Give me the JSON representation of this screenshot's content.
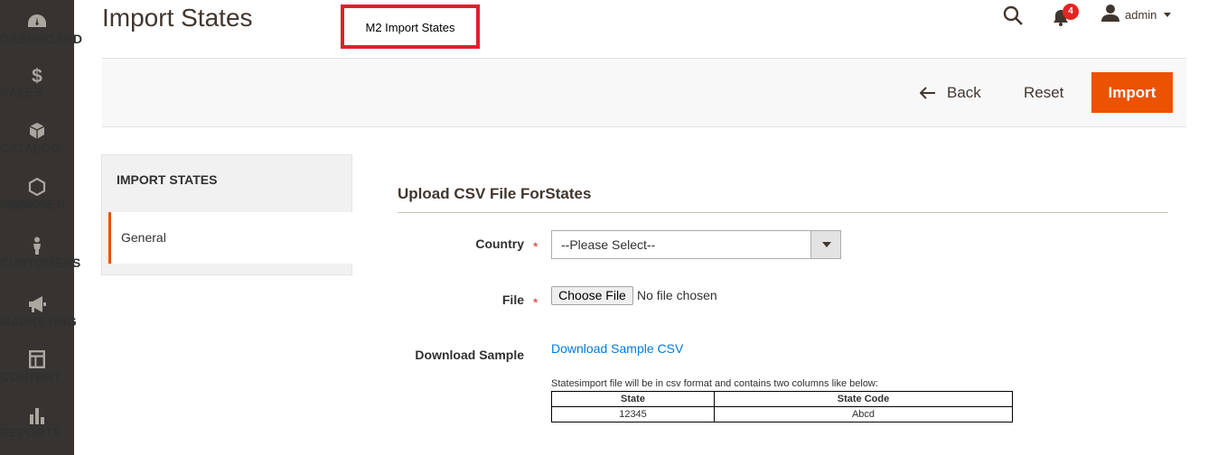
{
  "nav": {
    "items": [
      {
        "label": "DASHBOARD",
        "icon": "dashboard-icon"
      },
      {
        "label": "SALES",
        "icon": "dollar-icon"
      },
      {
        "label": "CATALOG",
        "icon": "cube-icon"
      },
      {
        "label": "REGION",
        "label2": "MANAGER",
        "icon": "hexagon-icon"
      },
      {
        "label": "CUSTOMERS",
        "icon": "person-icon"
      },
      {
        "label": "MARKETING",
        "icon": "megaphone-icon"
      },
      {
        "label": "CONTENT",
        "icon": "layout-icon"
      },
      {
        "label": "REPORTS",
        "icon": "bar-chart-icon"
      }
    ]
  },
  "header": {
    "title": "Import States",
    "tag": "M2 Import States",
    "notifications_count": "4",
    "user": "admin"
  },
  "actions": {
    "back": "Back",
    "reset": "Reset",
    "import": "Import"
  },
  "tabs": {
    "title": "IMPORT STATES",
    "general": "General"
  },
  "form": {
    "section_title": "Upload CSV File ForStates",
    "country_label": "Country",
    "country_value": "--Please Select--",
    "file_label": "File",
    "choose_file": "Choose File",
    "no_file": "No file chosen",
    "download_label": "Download Sample",
    "download_link": "Download Sample CSV",
    "note": "Statesimport file will be in csv format and contains two columns like below:",
    "table": {
      "headers": [
        "State",
        "State Code"
      ],
      "rows": [
        [
          "12345",
          "Abcd"
        ]
      ]
    }
  },
  "colors": {
    "accent": "#eb5202",
    "nav_bg": "#373330",
    "highlight_box": "#e0202a",
    "link": "#007bdb"
  }
}
